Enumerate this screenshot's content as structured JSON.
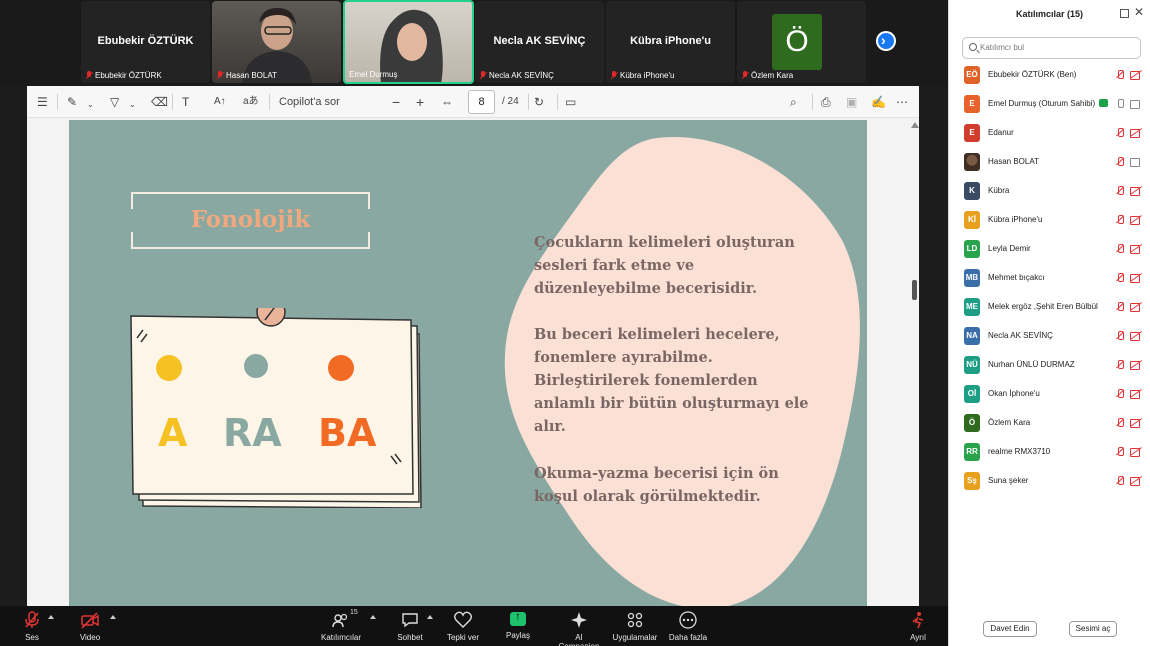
{
  "videos": [
    {
      "name": "Ebubekir ÖZTÜRK",
      "label": "Ebubekir ÖZTÜRK",
      "kind": "name"
    },
    {
      "name": "",
      "label": "Hasan BOLAT",
      "kind": "camera"
    },
    {
      "name": "",
      "label": "Emel Durmuş",
      "kind": "camera-active"
    },
    {
      "name": "Necla AK SEVİNÇ",
      "label": "Necla AK SEVİNÇ",
      "kind": "name"
    },
    {
      "name": "Kübra iPhone'u",
      "label": "Kübra iPhone'u",
      "kind": "name"
    },
    {
      "name": "Ö",
      "label": "Özlem Kara",
      "kind": "avatar"
    }
  ],
  "toolbar": {
    "copilot": "Copilot'a sor",
    "zoom_out": "−",
    "zoom_in": "+",
    "page_current": "8",
    "page_total": "/ 24"
  },
  "slide": {
    "title": "Fonolojik",
    "paragraphs": [
      [
        "Çocukların kelimeleri oluşturan",
        "sesleri fark etme ve",
        "düzenleyebilme becerisidir."
      ],
      [
        "Bu beceri kelimeleri hecelere,",
        "fonemlere ayırabilme.",
        "Birleştirilerek fonemlerden",
        "anlamlı bir bütün oluşturmayı ele",
        "alır."
      ],
      [
        "Okuma-yazma becerisi için ön",
        "koşul olarak görülmektedir."
      ]
    ],
    "syllables": [
      "A",
      "RA",
      "BA"
    ],
    "colors": {
      "a": "#f5c123",
      "ra": "#8aa8a2",
      "ba": "#f26b24",
      "text": "#7a6763",
      "title": "#f0a87e",
      "background": "#8aa8a2",
      "blob": "#fbe0d6"
    }
  },
  "bottom_bar": {
    "audio": "Ses",
    "video": "Video",
    "participants": "Katılımcılar",
    "participants_count": "15",
    "chat": "Sohbet",
    "react": "Tepki ver",
    "share": "Paylaş",
    "companion": "AI Companion",
    "apps": "Uygulamalar",
    "more": "Daha fazla",
    "leave": "Ayrıl"
  },
  "panel": {
    "title": "Katılımcılar (15)",
    "search_placeholder": "Katılımcı bul",
    "invite": "Davet Edin",
    "unmute": "Sesimi aç",
    "participants": [
      {
        "initials": "EÖ",
        "name": "Ebubekir ÖZTÜRK (Ben)",
        "color": "#e0632a",
        "mic": "off",
        "cam": "off"
      },
      {
        "initials": "E",
        "name": "Emel Durmuş (Oturum Sahibi)",
        "color": "#e8632a",
        "mic": "on",
        "cam": "on",
        "host": true
      },
      {
        "initials": "E",
        "name": "Edanur",
        "color": "#d23c2c",
        "mic": "off",
        "cam": "off"
      },
      {
        "initials": "",
        "name": "Hasan BOLAT",
        "color": "",
        "photo": true,
        "mic": "off",
        "cam": "on"
      },
      {
        "initials": "K",
        "name": "Kübra",
        "color": "#3b4a63",
        "mic": "off",
        "cam": "off"
      },
      {
        "initials": "Kİ",
        "name": "Kübra iPhone'u",
        "color": "#e8a01e",
        "mic": "off",
        "cam": "off"
      },
      {
        "initials": "LD",
        "name": "Leyla Demir",
        "color": "#2aa44c",
        "mic": "off",
        "cam": "off"
      },
      {
        "initials": "MB",
        "name": "Mehmet bıçakcı",
        "color": "#3a6ea8",
        "mic": "off",
        "cam": "off"
      },
      {
        "initials": "ME",
        "name": "Melek ergöz ,Şehit Eren Bülbül",
        "color": "#1e9e84",
        "mic": "off",
        "cam": "off"
      },
      {
        "initials": "NA",
        "name": "Necla AK SEVİNÇ",
        "color": "#3a6ea8",
        "mic": "off",
        "cam": "off"
      },
      {
        "initials": "NÜ",
        "name": "Nurhan ÜNLÜ DURMAZ",
        "color": "#1e9e84",
        "mic": "off",
        "cam": "off"
      },
      {
        "initials": "Oİ",
        "name": "Okan İphone'u",
        "color": "#1e9e84",
        "mic": "off",
        "cam": "off"
      },
      {
        "initials": "Ö",
        "name": "Özlem Kara",
        "color": "#2f6b1f",
        "mic": "off",
        "cam": "off"
      },
      {
        "initials": "RR",
        "name": "realme RMX3710",
        "color": "#2aa44c",
        "mic": "off",
        "cam": "off"
      },
      {
        "initials": "Sş",
        "name": "Suna şeker",
        "color": "#e8a01e",
        "mic": "off",
        "cam": "off"
      }
    ]
  }
}
